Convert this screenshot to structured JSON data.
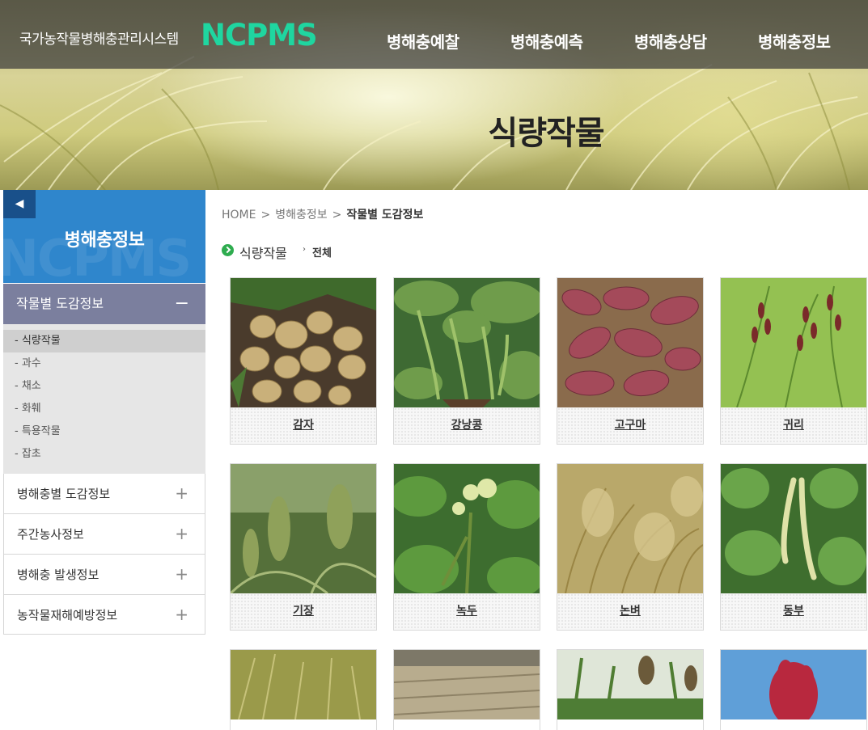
{
  "header": {
    "site_name": "국가농작물병해충관리시스템",
    "logo": "NCPMS",
    "nav": [
      "병해충예찰",
      "병해충예측",
      "병해충상담",
      "병해충정보"
    ],
    "page_title": "식량작물"
  },
  "sidebar": {
    "back_icon": "◀",
    "title": "병해충정보",
    "watermark": "NCPMS",
    "active_menu": {
      "label": "작물별 도감정보",
      "toggle": "−"
    },
    "submenu": [
      "- 식량작물",
      "- 과수",
      "- 채소",
      "- 화훼",
      "- 특용작물",
      "- 잡초"
    ],
    "items": [
      {
        "label": "병해충별 도감정보",
        "toggle": "+"
      },
      {
        "label": "주간농사정보",
        "toggle": "+"
      },
      {
        "label": "병해충 발생정보",
        "toggle": "+"
      },
      {
        "label": "농작물재해예방정보",
        "toggle": "+"
      }
    ]
  },
  "breadcrumb": {
    "home": "HOME",
    "sep": ">",
    "level1": "병해충정보",
    "current": "작물별 도감정보"
  },
  "category": {
    "label": "식량작물",
    "arrow": "›",
    "sub": "전체"
  },
  "crops": [
    {
      "name": "감자",
      "photo": "potato-photo"
    },
    {
      "name": "강낭콩",
      "photo": "kidney-bean-photo"
    },
    {
      "name": "고구마",
      "photo": "sweet-potato-photo"
    },
    {
      "name": "귀리",
      "photo": "oat-photo"
    },
    {
      "name": "기장",
      "photo": "millet-photo"
    },
    {
      "name": "녹두",
      "photo": "mung-bean-photo"
    },
    {
      "name": "논벼",
      "photo": "paddy-rice-photo"
    },
    {
      "name": "동부",
      "photo": "cowpea-photo"
    },
    {
      "name": "",
      "photo": "wheat-field-photo"
    },
    {
      "name": "",
      "photo": "grain-field-photo"
    },
    {
      "name": "",
      "photo": "sorghum-photo"
    },
    {
      "name": "",
      "photo": "amaranth-photo"
    }
  ],
  "colors": {
    "logo": "#1fd6a0",
    "sidebar_head": "#2f86cc",
    "sidebar_active": "#7b7f9e",
    "bullet": "#2eac4f"
  }
}
